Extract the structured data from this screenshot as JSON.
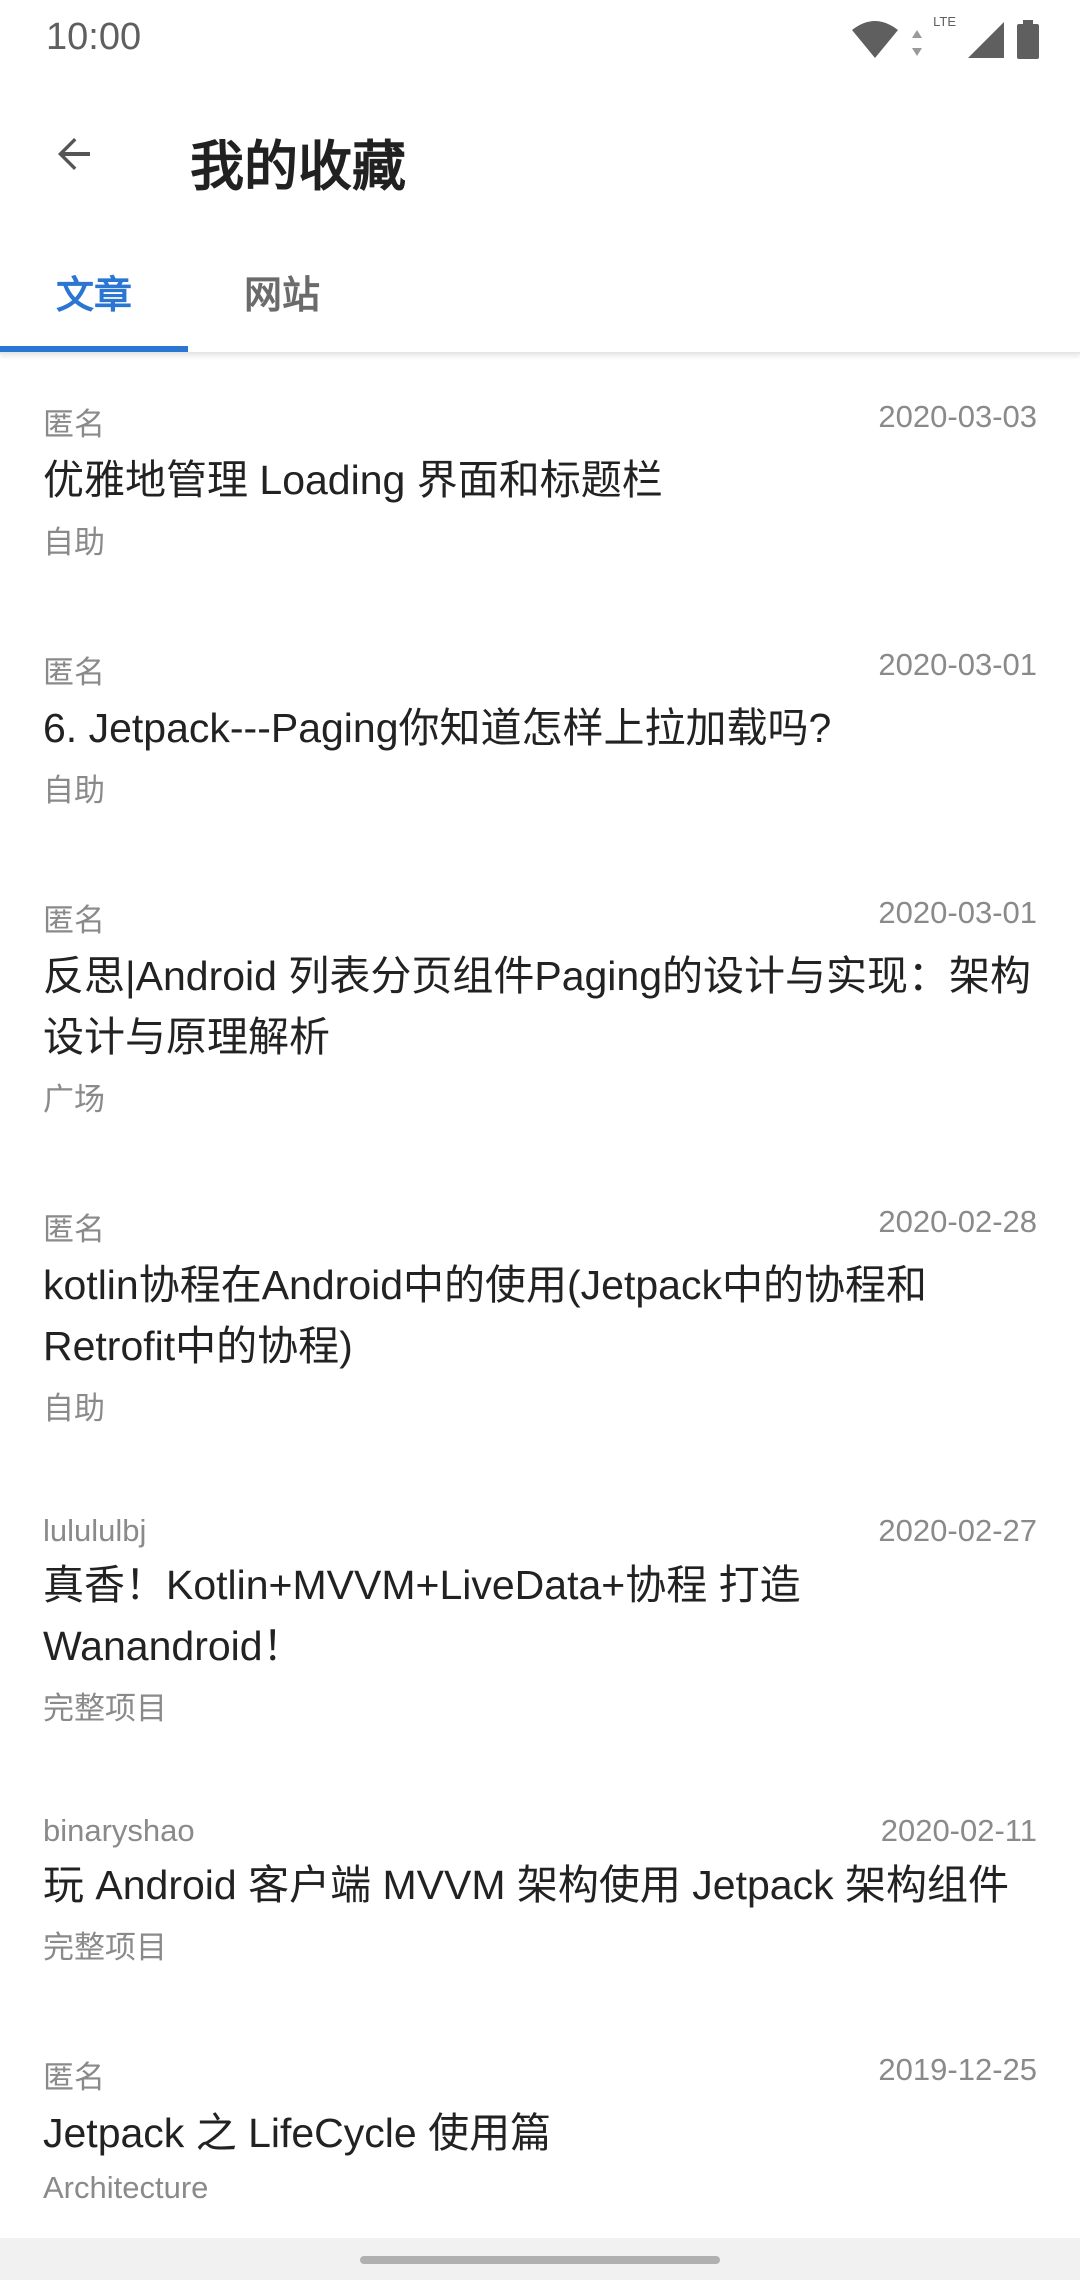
{
  "status_bar": {
    "time": "10:00",
    "network": "LTE",
    "icons": [
      "wifi-icon",
      "lte-icon",
      "signal-icon",
      "battery-icon"
    ]
  },
  "app_bar": {
    "title": "我的收藏",
    "back_icon": "arrow-back-icon"
  },
  "tabs": [
    {
      "label": "文章",
      "selected": true
    },
    {
      "label": "网站",
      "selected": false
    }
  ],
  "colors": {
    "accent": "#2a76d2",
    "meta_text": "#8a8a8a",
    "title_text": "#222222"
  },
  "articles": [
    {
      "author": "匿名",
      "date": "2020-03-03",
      "title": "优雅地管理 Loading 界面和标题栏",
      "chapter": "自助"
    },
    {
      "author": "匿名",
      "date": "2020-03-01",
      "title": "6. Jetpack---Paging你知道怎样上拉加载吗?",
      "chapter": "自助"
    },
    {
      "author": "匿名",
      "date": "2020-03-01",
      "title": "反思|Android 列表分页组件Paging的设计与实现：架构设计与原理解析",
      "chapter": "广场"
    },
    {
      "author": "匿名",
      "date": "2020-02-28",
      "title": "kotlin协程在Android中的使用(Jetpack中的协程和Retrofit中的协程)",
      "chapter": "自助"
    },
    {
      "author": "lulululbj",
      "date": "2020-02-27",
      "title": "真香！Kotlin+MVVM+LiveData+协程 打造 Wanandroid！",
      "chapter": "完整项目"
    },
    {
      "author": "binaryshao",
      "date": "2020-02-11",
      "title": "玩 Android 客户端 MVVM 架构使用 Jetpack 架构组件",
      "chapter": "完整项目"
    },
    {
      "author": "匿名",
      "date": "2019-12-25",
      "title": "Jetpack 之 LifeCycle 使用篇",
      "chapter": "Architecture"
    }
  ]
}
